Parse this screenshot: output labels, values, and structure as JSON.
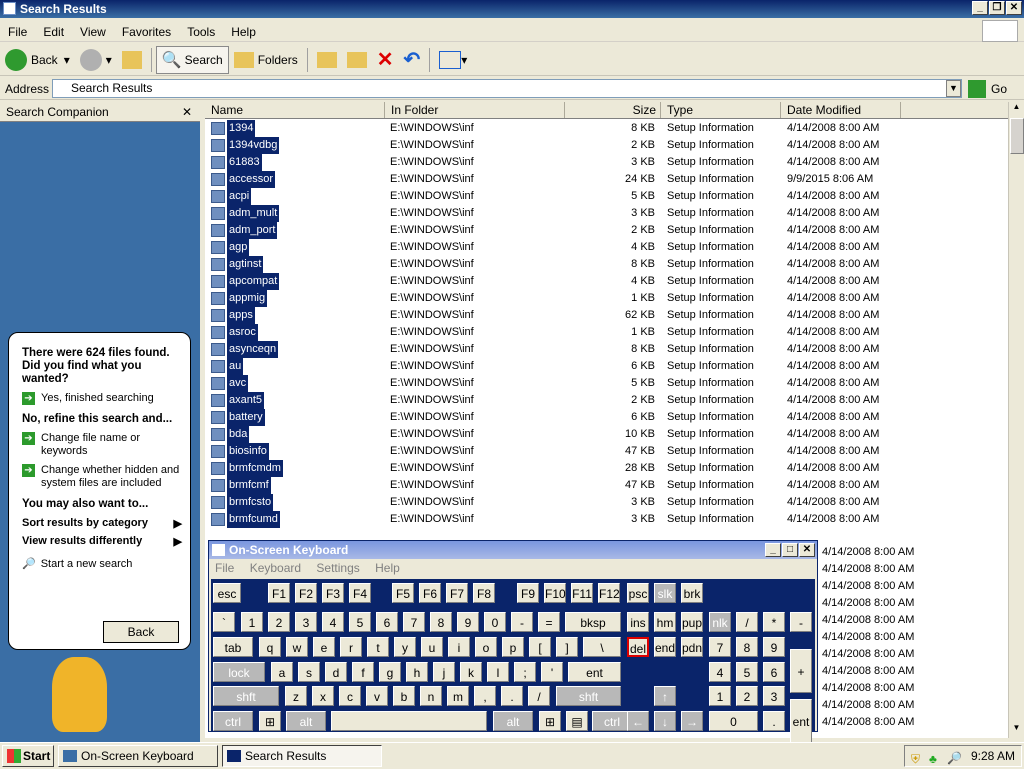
{
  "window": {
    "title": "Search Results"
  },
  "menu": [
    "File",
    "Edit",
    "View",
    "Favorites",
    "Tools",
    "Help"
  ],
  "toolbar": {
    "back": "Back",
    "search": "Search",
    "folders": "Folders"
  },
  "address": {
    "label": "Address",
    "value": "Search Results",
    "go": "Go"
  },
  "companion": {
    "header": "Search Companion",
    "found": "There were 624 files found. Did you find what you wanted?",
    "yes": "Yes, finished searching",
    "refine": "No, refine this search and...",
    "change_name": "Change file name or keywords",
    "change_hidden": "Change whether hidden and system files are included",
    "also": "You may also want to...",
    "sort": "Sort results by category",
    "view": "View results differently",
    "new_search": "Start a new search",
    "back": "Back"
  },
  "columns": [
    "Name",
    "In Folder",
    "Size",
    "Type",
    "Date Modified"
  ],
  "rows": [
    {
      "name": "1394",
      "folder": "E:\\WINDOWS\\inf",
      "size": "8 KB",
      "type": "Setup Information",
      "date": "4/14/2008 8:00 AM"
    },
    {
      "name": "1394vdbg",
      "folder": "E:\\WINDOWS\\inf",
      "size": "2 KB",
      "type": "Setup Information",
      "date": "4/14/2008 8:00 AM"
    },
    {
      "name": "61883",
      "folder": "E:\\WINDOWS\\inf",
      "size": "3 KB",
      "type": "Setup Information",
      "date": "4/14/2008 8:00 AM"
    },
    {
      "name": "accessor",
      "folder": "E:\\WINDOWS\\inf",
      "size": "24 KB",
      "type": "Setup Information",
      "date": "9/9/2015 8:06 AM"
    },
    {
      "name": "acpi",
      "folder": "E:\\WINDOWS\\inf",
      "size": "5 KB",
      "type": "Setup Information",
      "date": "4/14/2008 8:00 AM"
    },
    {
      "name": "adm_mult",
      "folder": "E:\\WINDOWS\\inf",
      "size": "3 KB",
      "type": "Setup Information",
      "date": "4/14/2008 8:00 AM"
    },
    {
      "name": "adm_port",
      "folder": "E:\\WINDOWS\\inf",
      "size": "2 KB",
      "type": "Setup Information",
      "date": "4/14/2008 8:00 AM"
    },
    {
      "name": "agp",
      "folder": "E:\\WINDOWS\\inf",
      "size": "4 KB",
      "type": "Setup Information",
      "date": "4/14/2008 8:00 AM"
    },
    {
      "name": "agtinst",
      "folder": "E:\\WINDOWS\\inf",
      "size": "8 KB",
      "type": "Setup Information",
      "date": "4/14/2008 8:00 AM"
    },
    {
      "name": "apcompat",
      "folder": "E:\\WINDOWS\\inf",
      "size": "4 KB",
      "type": "Setup Information",
      "date": "4/14/2008 8:00 AM"
    },
    {
      "name": "appmig",
      "folder": "E:\\WINDOWS\\inf",
      "size": "1 KB",
      "type": "Setup Information",
      "date": "4/14/2008 8:00 AM"
    },
    {
      "name": "apps",
      "folder": "E:\\WINDOWS\\inf",
      "size": "62 KB",
      "type": "Setup Information",
      "date": "4/14/2008 8:00 AM"
    },
    {
      "name": "asroc",
      "folder": "E:\\WINDOWS\\inf",
      "size": "1 KB",
      "type": "Setup Information",
      "date": "4/14/2008 8:00 AM"
    },
    {
      "name": "asynceqn",
      "folder": "E:\\WINDOWS\\inf",
      "size": "8 KB",
      "type": "Setup Information",
      "date": "4/14/2008 8:00 AM"
    },
    {
      "name": "au",
      "folder": "E:\\WINDOWS\\inf",
      "size": "6 KB",
      "type": "Setup Information",
      "date": "4/14/2008 8:00 AM"
    },
    {
      "name": "avc",
      "folder": "E:\\WINDOWS\\inf",
      "size": "5 KB",
      "type": "Setup Information",
      "date": "4/14/2008 8:00 AM"
    },
    {
      "name": "axant5",
      "folder": "E:\\WINDOWS\\inf",
      "size": "2 KB",
      "type": "Setup Information",
      "date": "4/14/2008 8:00 AM"
    },
    {
      "name": "battery",
      "folder": "E:\\WINDOWS\\inf",
      "size": "6 KB",
      "type": "Setup Information",
      "date": "4/14/2008 8:00 AM"
    },
    {
      "name": "bda",
      "folder": "E:\\WINDOWS\\inf",
      "size": "10 KB",
      "type": "Setup Information",
      "date": "4/14/2008 8:00 AM"
    },
    {
      "name": "biosinfo",
      "folder": "E:\\WINDOWS\\inf",
      "size": "47 KB",
      "type": "Setup Information",
      "date": "4/14/2008 8:00 AM"
    },
    {
      "name": "brmfcmdm",
      "folder": "E:\\WINDOWS\\inf",
      "size": "28 KB",
      "type": "Setup Information",
      "date": "4/14/2008 8:00 AM"
    },
    {
      "name": "brmfcmf",
      "folder": "E:\\WINDOWS\\inf",
      "size": "47 KB",
      "type": "Setup Information",
      "date": "4/14/2008 8:00 AM"
    },
    {
      "name": "brmfcsto",
      "folder": "E:\\WINDOWS\\inf",
      "size": "3 KB",
      "type": "Setup Information",
      "date": "4/14/2008 8:00 AM"
    },
    {
      "name": "brmfcumd",
      "folder": "E:\\WINDOWS\\inf",
      "size": "3 KB",
      "type": "Setup Information",
      "date": "4/14/2008 8:00 AM"
    }
  ],
  "hidden_dates": [
    "4/14/2008 8:00 AM",
    "4/14/2008 8:00 AM",
    "4/14/2008 8:00 AM",
    "4/14/2008 8:00 AM",
    "4/14/2008 8:00 AM",
    "4/14/2008 8:00 AM",
    "4/14/2008 8:00 AM",
    "4/14/2008 8:00 AM",
    "4/14/2008 8:00 AM",
    "4/14/2008 8:00 AM",
    "4/14/2008 8:00 AM"
  ],
  "osk": {
    "title": "On-Screen Keyboard",
    "menu": [
      "File",
      "Keyboard",
      "Settings",
      "Help"
    ]
  },
  "taskbar": {
    "start": "Start",
    "tasks": [
      "On-Screen Keyboard",
      "Search Results"
    ],
    "clock": "9:28 AM"
  }
}
